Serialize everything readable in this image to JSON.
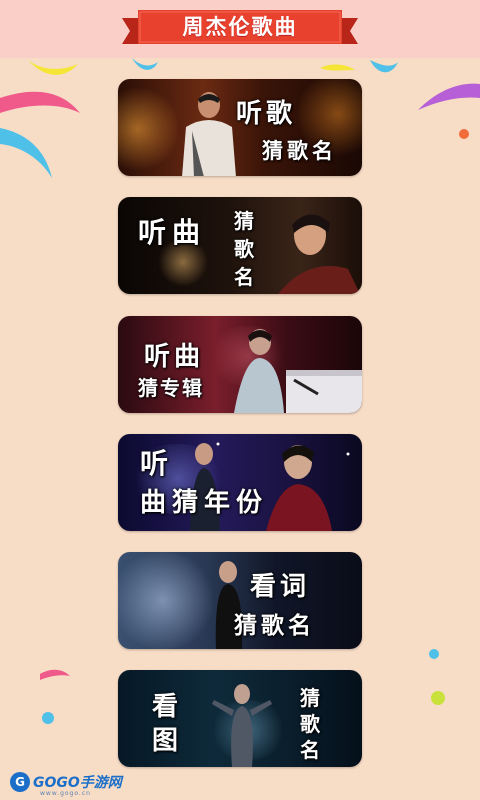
{
  "header": {
    "title": "周杰伦歌曲"
  },
  "cards": [
    {
      "line1": "听歌",
      "line2": "猜歌名"
    },
    {
      "line1": "听曲",
      "line2": "猜",
      "line3": "歌",
      "line4": "名"
    },
    {
      "line1": "听曲",
      "line2": "猜专辑"
    },
    {
      "line1": "听",
      "line2": "曲猜年份"
    },
    {
      "line1": "看词",
      "line2": "猜歌名"
    },
    {
      "line1": "看",
      "line2": "图",
      "line3": "猜",
      "line4": "歌",
      "line5": "名"
    }
  ],
  "watermark": {
    "brand": "GOGO手游网",
    "url": "www.gogo.cn"
  },
  "colors": {
    "background": "#f7dcc6",
    "header_bg": "#f9cfc8",
    "ribbon": "#e8412d",
    "ribbon_dark": "#b8261a"
  }
}
